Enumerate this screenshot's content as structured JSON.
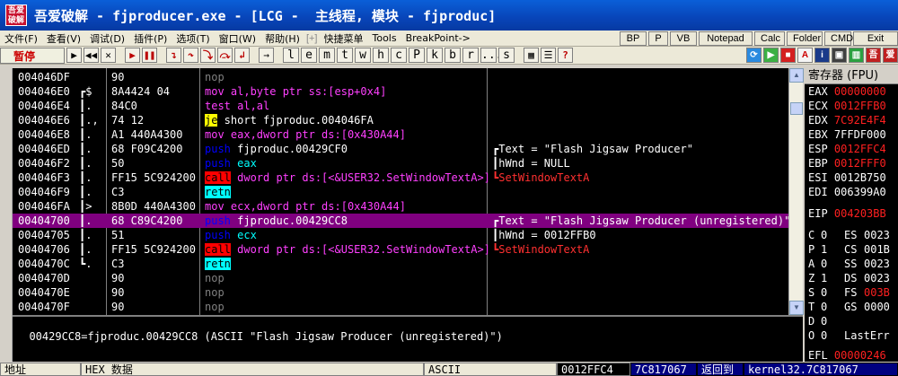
{
  "title": {
    "app_icon": "吾爱破解",
    "text": "吾爱破解 - fjproducer.exe - [LCG -  主线程, 模块 - fjproduc]"
  },
  "menu": {
    "items": [
      "文件(F)",
      "查看(V)",
      "调试(D)",
      "插件(P)",
      "选项(T)",
      "窗口(W)",
      "帮助(H)"
    ],
    "plus": "[+]",
    "extra": [
      "快捷菜单",
      "Tools",
      "BreakPoint->"
    ],
    "buttons": [
      "BP",
      "P",
      "VB",
      "Notepad",
      "Calc",
      "Folder",
      "CMD",
      "Exit"
    ]
  },
  "toolbar": {
    "status": "暂停",
    "letters": [
      "l",
      "e",
      "m",
      "t",
      "w",
      "h",
      "c",
      "P",
      "k",
      "b",
      "r",
      "...",
      "s"
    ]
  },
  "disasm": [
    {
      "addr": "004046DF",
      "mark": "",
      "hex": "90",
      "ins": [
        {
          "t": "nop",
          "c": "op-nop"
        }
      ],
      "cmt": ""
    },
    {
      "addr": "004046E0",
      "mark": "┏$",
      "hex": "8A4424 04",
      "ins": [
        {
          "t": "mov al,byte ptr ss:[esp+0x4]",
          "c": "op-mag"
        }
      ],
      "cmt": ""
    },
    {
      "addr": "004046E4",
      "mark": "┃.",
      "hex": "84C0",
      "ins": [
        {
          "t": "test al,al",
          "c": "op-mag"
        }
      ],
      "cmt": ""
    },
    {
      "addr": "004046E6",
      "mark": "┃.,",
      "hex": "74 12",
      "ins": [
        {
          "t": "je",
          "c": "op-jmp"
        },
        {
          "t": " short fjproduc.004046FA",
          "c": "op-white"
        }
      ],
      "cmt": ""
    },
    {
      "addr": "004046E8",
      "mark": "┃.",
      "hex": "A1 440A4300",
      "ins": [
        {
          "t": "mov eax,dword ptr ds:[0x430A44]",
          "c": "op-mag"
        }
      ],
      "cmt": ""
    },
    {
      "addr": "004046ED",
      "mark": "┃.",
      "hex": "68 F09C4200",
      "ins": [
        {
          "t": "push",
          "c": "op-blue"
        },
        {
          "t": " fjproduc.00429CF0",
          "c": "op-white"
        }
      ],
      "cmt": [
        {
          "t": "┏Text = \"Flash Jigsaw Producer\"",
          "c": "cm-white"
        }
      ]
    },
    {
      "addr": "004046F2",
      "mark": "┃.",
      "hex": "50",
      "ins": [
        {
          "t": "push",
          "c": "op-blue"
        },
        {
          "t": " eax",
          "c": "op-cyan"
        }
      ],
      "cmt": [
        {
          "t": "┃hWnd = NULL",
          "c": "cm-white"
        }
      ]
    },
    {
      "addr": "004046F3",
      "mark": "┃.",
      "hex": "FF15 5C924200",
      "ins": [
        {
          "t": "call",
          "c": "op-call"
        },
        {
          "t": " dword ptr ds:[<&USER32.SetWindowTextA>]",
          "c": "op-mag"
        }
      ],
      "cmt": [
        {
          "t": "┗SetWindowTextA",
          "c": "cm-red"
        }
      ]
    },
    {
      "addr": "004046F9",
      "mark": "┃.",
      "hex": "C3",
      "ins": [
        {
          "t": "retn",
          "c": "op-retn"
        }
      ],
      "cmt": ""
    },
    {
      "addr": "004046FA",
      "mark": "┃>",
      "hex": "8B0D 440A4300",
      "ins": [
        {
          "t": "mov ecx,dword ptr ds:[0x430A44]",
          "c": "op-mag"
        }
      ],
      "cmt": ""
    },
    {
      "addr": "00404700",
      "mark": "┃.",
      "hex": "68 C89C4200",
      "ins": [
        {
          "t": "push",
          "c": "op-blue"
        },
        {
          "t": " fjproduc.00429CC8",
          "c": "op-white"
        }
      ],
      "cmt": [
        {
          "t": "┏Text = \"Flash Jigsaw Producer (unregistered)\"",
          "c": "cm-white"
        }
      ],
      "sel": true
    },
    {
      "addr": "00404705",
      "mark": "┃.",
      "hex": "51",
      "ins": [
        {
          "t": "push",
          "c": "op-blue"
        },
        {
          "t": " ecx",
          "c": "op-cyan"
        }
      ],
      "cmt": [
        {
          "t": "┃hWnd = 0012FFB0",
          "c": "cm-white"
        }
      ]
    },
    {
      "addr": "00404706",
      "mark": "┃.",
      "hex": "FF15 5C924200",
      "ins": [
        {
          "t": "call",
          "c": "op-call"
        },
        {
          "t": " dword ptr ds:[<&USER32.SetWindowTextA>]",
          "c": "op-mag"
        }
      ],
      "cmt": [
        {
          "t": "┗SetWindowTextA",
          "c": "cm-red"
        }
      ]
    },
    {
      "addr": "0040470C",
      "mark": "┗.",
      "hex": "C3",
      "ins": [
        {
          "t": "retn",
          "c": "op-retn"
        }
      ],
      "cmt": ""
    },
    {
      "addr": "0040470D",
      "mark": "",
      "hex": "90",
      "ins": [
        {
          "t": "nop",
          "c": "op-nop"
        }
      ],
      "cmt": ""
    },
    {
      "addr": "0040470E",
      "mark": "",
      "hex": "90",
      "ins": [
        {
          "t": "nop",
          "c": "op-nop"
        }
      ],
      "cmt": ""
    },
    {
      "addr": "0040470F",
      "mark": "",
      "hex": "90",
      "ins": [
        {
          "t": "nop",
          "c": "op-nop"
        }
      ],
      "cmt": ""
    }
  ],
  "info": "00429CC8=fjproduc.00429CC8 (ASCII \"Flash Jigsaw Producer (unregistered)\")",
  "registers": {
    "title": "寄存器 (FPU)",
    "gp": [
      {
        "n": "EAX",
        "v": "00000000",
        "red": true
      },
      {
        "n": "ECX",
        "v": "0012FFB0",
        "red": true
      },
      {
        "n": "EDX",
        "v": "7C92E4F4",
        "red": true
      },
      {
        "n": "EBX",
        "v": "7FFDF000",
        "red": false
      },
      {
        "n": "ESP",
        "v": "0012FFC4",
        "red": true
      },
      {
        "n": "EBP",
        "v": "0012FFF0",
        "red": true
      },
      {
        "n": "ESI",
        "v": "0012B750",
        "red": false
      },
      {
        "n": "EDI",
        "v": "006399A0",
        "red": false
      }
    ],
    "eip": {
      "n": "EIP",
      "v": "004203BB",
      "red": true
    },
    "flags": [
      {
        "f": "C",
        "fv": "0",
        "s": "ES",
        "sv": "0023",
        "red": false
      },
      {
        "f": "P",
        "fv": "1",
        "s": "CS",
        "sv": "001B",
        "red": false
      },
      {
        "f": "A",
        "fv": "0",
        "s": "SS",
        "sv": "0023",
        "red": false
      },
      {
        "f": "Z",
        "fv": "1",
        "s": "DS",
        "sv": "0023",
        "red": false
      },
      {
        "f": "S",
        "fv": "0",
        "s": "FS",
        "sv": "003B",
        "red": true
      },
      {
        "f": "T",
        "fv": "0",
        "s": "GS",
        "sv": "0000",
        "red": false
      },
      {
        "f": "D",
        "fv": "0",
        "s": "",
        "sv": "",
        "red": false
      },
      {
        "f": "O",
        "fv": "0",
        "s": "LastErr",
        "sv": "",
        "red": false
      }
    ],
    "efl": {
      "n": "EFL",
      "v": "00000246",
      "red": true
    }
  },
  "bottom": {
    "addr": "地址",
    "hex": "HEX 数据",
    "ascii": "ASCII",
    "stack_addr": "0012FFC4",
    "stack_val": "7C817067",
    "stack_cmt1": "返回到",
    "stack_cmt2": "kernel32.7C817067"
  }
}
